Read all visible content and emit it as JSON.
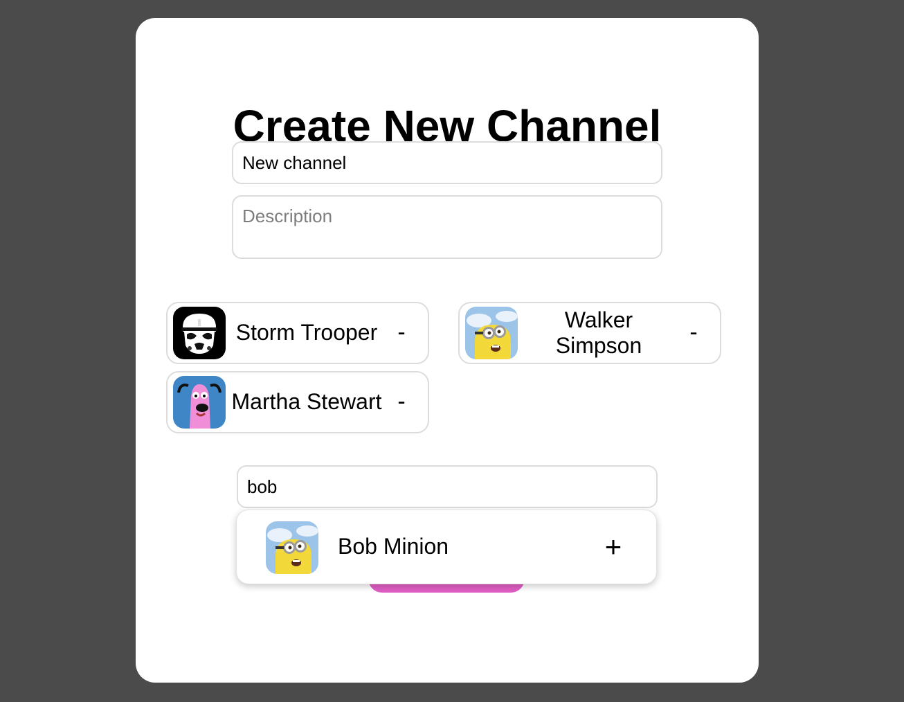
{
  "modal": {
    "title": "Create New Channel",
    "name_input": {
      "value": "New channel",
      "placeholder": ""
    },
    "description_input": {
      "value": "",
      "placeholder": "Description"
    }
  },
  "members": [
    {
      "name": "Storm Trooper",
      "avatar": "stormtrooper-avatar",
      "action": "-"
    },
    {
      "name": "Walker Simpson",
      "avatar": "minion-avatar",
      "action": "-"
    },
    {
      "name": "Martha Stewart",
      "avatar": "courage-dog-avatar",
      "action": "-"
    }
  ],
  "search": {
    "value": "bob",
    "results": [
      {
        "name": "Bob Minion",
        "avatar": "minion-avatar",
        "action": "+"
      }
    ]
  },
  "colors": {
    "backdrop": "#4b4b4b",
    "accent": "#e05ec4"
  }
}
